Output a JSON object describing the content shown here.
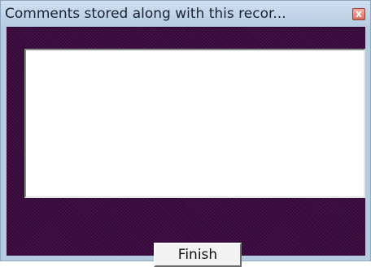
{
  "window": {
    "title": "Comments stored along with this recor...",
    "close_label": "x",
    "background_color": "#3b0a3f"
  },
  "comments": {
    "value": ""
  },
  "actions": {
    "finish_label": "Finish"
  }
}
